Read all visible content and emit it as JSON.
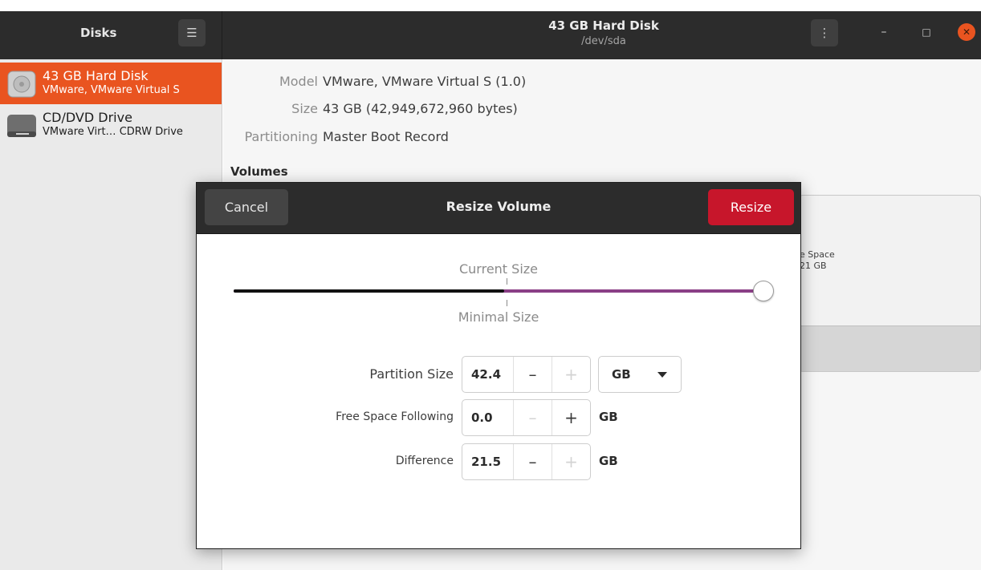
{
  "app": {
    "title": "Disks",
    "menu_icon": "hamburger-icon"
  },
  "header": {
    "title": "43 GB Hard Disk",
    "subtitle": "/dev/sda",
    "kebab_icon": "vertical-ellipsis-icon",
    "window_controls": {
      "minimize": "–",
      "maximize": "□",
      "close": "✕"
    }
  },
  "sidebar": {
    "drives": [
      {
        "name": "43 GB Hard Disk",
        "subtitle": "VMware, VMware Virtual S",
        "icon": "hard-disk-icon",
        "selected": true
      },
      {
        "name": "CD/DVD Drive",
        "subtitle": "VMware Virt… CDRW Drive",
        "icon": "optical-drive-icon",
        "selected": false
      }
    ]
  },
  "details": {
    "model_label": "Model",
    "model_value": "VMware, VMware Virtual S (1.0)",
    "size_label": "Size",
    "size_value": "43 GB (42,949,672,960 bytes)",
    "partitioning_label": "Partitioning",
    "partitioning_value": "Master Boot Record",
    "volumes_heading": "Volumes",
    "volume_partial_line1": "e Space",
    "volume_partial_line2": "21 GB"
  },
  "dialog": {
    "title": "Resize Volume",
    "cancel_label": "Cancel",
    "resize_label": "Resize",
    "current_size_label": "Current Size",
    "minimal_size_label": "Minimal Size",
    "slider_value_fraction": 1.0,
    "minimal_marker_fraction": 0.51,
    "rows": {
      "partition_size": {
        "label": "Partition Size",
        "value": "42.4",
        "unit": "GB",
        "minus": "–",
        "plus": "+"
      },
      "free_space": {
        "label": "Free Space Following",
        "value": "0.0",
        "unit": "GB",
        "minus": "–",
        "plus": "+"
      },
      "difference": {
        "label": "Difference",
        "value": "21.5",
        "unit": "GB",
        "minus": "–",
        "plus": "+"
      }
    }
  },
  "colors": {
    "accent": "#e95420",
    "destructive": "#c7162b",
    "slider_track": "#8a3f86"
  }
}
